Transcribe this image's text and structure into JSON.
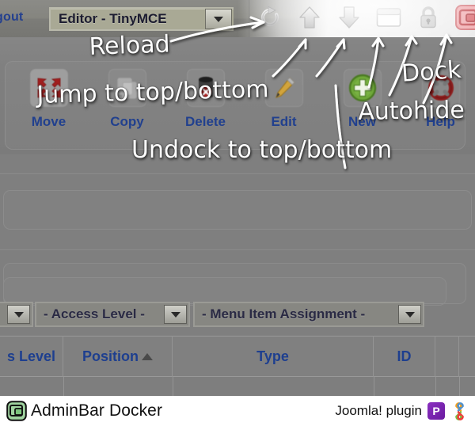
{
  "admin_bar": {
    "logout_label": "gout",
    "editor_select": {
      "value": "Editor - TinyMCE",
      "caret_icon": "chevron-down-icon"
    }
  },
  "dock_controls": [
    {
      "name": "reload",
      "icon": "reload-icon",
      "tooltip": "Reload"
    },
    {
      "name": "jump-top",
      "icon": "arrow-up-icon",
      "tooltip": "Jump to top"
    },
    {
      "name": "jump-bottom",
      "icon": "arrow-down-icon",
      "tooltip": "Jump to bottom"
    },
    {
      "name": "undock",
      "icon": "window-icon",
      "tooltip": "Undock to top/bottom"
    },
    {
      "name": "autohide",
      "icon": "lock-icon",
      "tooltip": "Autohide"
    },
    {
      "name": "dock",
      "icon": "dock-icon",
      "tooltip": "Dock"
    }
  ],
  "toolbar": {
    "buttons": [
      {
        "label": "Move",
        "icon": "move-arrows-icon"
      },
      {
        "label": "Copy",
        "icon": "copy-icon"
      },
      {
        "label": "Delete",
        "icon": "trash-delete-icon"
      },
      {
        "label": "Edit",
        "icon": "pencil-edit-icon"
      },
      {
        "label": "New",
        "icon": "plus-circle-icon"
      },
      {
        "label": "Help",
        "icon": "lifebuoy-help-icon"
      }
    ]
  },
  "filters": [
    {
      "label": "- Access Level -",
      "caret_icon": "chevron-down-icon"
    },
    {
      "label": "- Menu Item Assignment -",
      "caret_icon": "chevron-down-icon"
    }
  ],
  "filter_leading_caret": "chevron-down-icon",
  "table": {
    "headers": [
      {
        "label": "s Level",
        "sorted": false
      },
      {
        "label": "Position",
        "sorted": true,
        "sort_icon": "sort-ascending-icon"
      },
      {
        "label": "Type",
        "sorted": false
      },
      {
        "label": "ID",
        "sorted": false
      }
    ]
  },
  "annotations": [
    {
      "text": "Reload",
      "id": "annotation-reload"
    },
    {
      "text": "Jump to top/bottom",
      "id": "annotation-jump"
    },
    {
      "text": "Undock to top/bottom",
      "id": "annotation-undock"
    },
    {
      "text": "Dock",
      "id": "annotation-dock"
    },
    {
      "text": "Autohide",
      "id": "annotation-autohide"
    }
  ],
  "footer": {
    "brand_icon": "adminbar-docker-logo-icon",
    "brand_name": "AdminBar Docker",
    "plugin_text": "Joomla! plugin",
    "badge_letter": "P",
    "joomla_icon": "joomla-logo-icon"
  },
  "colors": {
    "page_bg": "#7f7f7f",
    "link_blue": "#21408e",
    "dock_red": "#c94f53",
    "new_green": "#5aa02c",
    "help_dark_red": "#8f1a1a",
    "badge_purple": "#7a22b5",
    "annotation_white": "#ffffff"
  }
}
